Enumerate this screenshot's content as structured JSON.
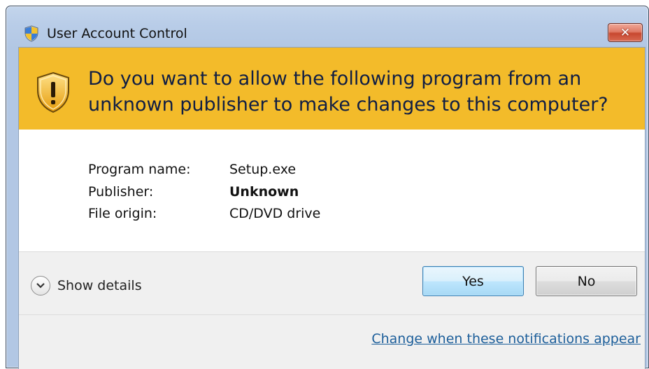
{
  "window": {
    "title": "User Account Control",
    "close_label": "✕"
  },
  "banner": {
    "line1": "Do you want to allow the following program from an",
    "line2": "unknown publisher to make changes to this computer?"
  },
  "info": {
    "rows": [
      {
        "label": "Program name:",
        "value": "Setup.exe"
      },
      {
        "label": "Publisher:",
        "value": "Unknown"
      },
      {
        "label": "File origin:",
        "value": "CD/DVD drive"
      }
    ]
  },
  "footer": {
    "details_label": "Show details",
    "yes_label": "Yes",
    "no_label": "No",
    "link_label": "Change when these notifications appear"
  },
  "icons": {
    "title": "uac-shield-icon",
    "banner": "warning-shield-icon",
    "details": "chevron-down-icon",
    "close": "close-icon"
  },
  "colors": {
    "banner": "#f3bb2a",
    "banner_text": "#101e44",
    "link": "#1c5e9a",
    "close_button": "#c84830",
    "titlebar": "#b9cde8"
  }
}
